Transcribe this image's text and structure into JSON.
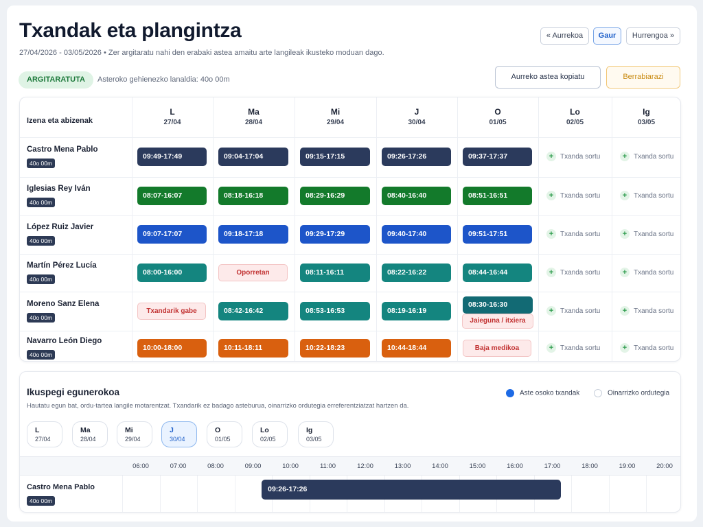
{
  "page": {
    "title": "Txandak eta plangintza",
    "date_range": "27/04/2026 - 03/05/2026",
    "info": "Zer argitaratu nahi den erabaki astea amaitu arte langileak ikusteko moduan dago.",
    "status": "ARGITARATUTA",
    "max_hours": "Asteroko gehienezko lanaldia: 40o 00m"
  },
  "nav": {
    "prev": "« Aurrekoa",
    "today": "Gaur",
    "next": "Hurrengoa »"
  },
  "actions": {
    "copy": "Aurreko astea kopiatu",
    "reset": "Berrabiarazi"
  },
  "schedule": {
    "name_header": "Izena eta abizenak",
    "days": [
      {
        "d": "L",
        "dt": "27/04"
      },
      {
        "d": "Ma",
        "dt": "28/04"
      },
      {
        "d": "Mi",
        "dt": "29/04"
      },
      {
        "d": "J",
        "dt": "30/04"
      },
      {
        "d": "O",
        "dt": "01/05"
      },
      {
        "d": "Lo",
        "dt": "02/05"
      },
      {
        "d": "Ig",
        "dt": "03/05"
      }
    ],
    "add_label": "Txanda sortu",
    "rows": [
      {
        "name": "Castro Mena Pablo",
        "hours": "40o 00m",
        "color": "#2b3a5c",
        "cells": [
          [
            "shift",
            "09:49-17:49"
          ],
          [
            "shift",
            "09:04-17:04"
          ],
          [
            "shift",
            "09:15-17:15"
          ],
          [
            "shift",
            "09:26-17:26"
          ],
          [
            "shift",
            "09:37-17:37"
          ]
        ]
      },
      {
        "name": "Iglesias Rey Iván",
        "hours": "40o 00m",
        "color": "#137a2b",
        "cells": [
          [
            "shift",
            "08:07-16:07"
          ],
          [
            "shift",
            "08:18-16:18"
          ],
          [
            "shift",
            "08:29-16:29"
          ],
          [
            "shift",
            "08:40-16:40"
          ],
          [
            "shift",
            "08:51-16:51"
          ]
        ]
      },
      {
        "name": "López Ruiz Javier",
        "hours": "40o 00m",
        "color": "#1d55c9",
        "cells": [
          [
            "shift",
            "09:07-17:07"
          ],
          [
            "shift",
            "09:18-17:18"
          ],
          [
            "shift",
            "09:29-17:29"
          ],
          [
            "shift",
            "09:40-17:40"
          ],
          [
            "shift",
            "09:51-17:51"
          ]
        ]
      },
      {
        "name": "Martín Pérez Lucía",
        "hours": "40o 00m",
        "color": "#14857f",
        "cells": [
          [
            "shift",
            "08:00-16:00"
          ],
          [
            "tag",
            "Oporretan"
          ],
          [
            "shift",
            "08:11-16:11"
          ],
          [
            "shift",
            "08:22-16:22"
          ],
          [
            "shift",
            "08:44-16:44"
          ]
        ]
      },
      {
        "name": "Moreno Sanz Elena",
        "hours": "40o 00m",
        "color": "#14857f",
        "cells": [
          [
            "tag",
            "Txandarik gabe"
          ],
          [
            "shift",
            "08:42-16:42"
          ],
          [
            "shift",
            "08:53-16:53"
          ],
          [
            "shift",
            "08:19-16:19"
          ],
          [
            "shift+tag",
            "08:30-16:30",
            "Jaieguna / itxiera"
          ]
        ]
      },
      {
        "name": "Navarro León Diego",
        "hours": "40o 00m",
        "color": "#d9600f",
        "cells": [
          [
            "shift",
            "10:00-18:00"
          ],
          [
            "shift",
            "10:11-18:11"
          ],
          [
            "shift",
            "10:22-18:23"
          ],
          [
            "shift",
            "10:44-18:44"
          ],
          [
            "tag",
            "Baja medikoa"
          ]
        ]
      }
    ]
  },
  "daily": {
    "title": "Ikuspegi egunerokoa",
    "desc": "Hautatu egun bat, ordu-tartea langile motarentzat. Txandarik ez badago asteburua, oinarrizko ordutegia erreferentziatzat hartzen da.",
    "radio_week": "Aste osoko txandak",
    "radio_base": "Oinarrizko ordutegia",
    "days": [
      {
        "d": "L",
        "dt": "27/04"
      },
      {
        "d": "Ma",
        "dt": "28/04"
      },
      {
        "d": "Mi",
        "dt": "29/04"
      },
      {
        "d": "J",
        "dt": "30/04"
      },
      {
        "d": "O",
        "dt": "01/05"
      },
      {
        "d": "Lo",
        "dt": "02/05"
      },
      {
        "d": "Ig",
        "dt": "03/05"
      }
    ],
    "selected_day": "J",
    "hours": [
      "06:00",
      "07:00",
      "08:00",
      "09:00",
      "10:00",
      "11:00",
      "12:00",
      "13:00",
      "14:00",
      "15:00",
      "16:00",
      "17:00",
      "18:00",
      "19:00",
      "20:00"
    ],
    "employee": {
      "name": "Castro Mena Pablo",
      "hours": "40o 00m",
      "shift": "09:26-17:26"
    }
  }
}
